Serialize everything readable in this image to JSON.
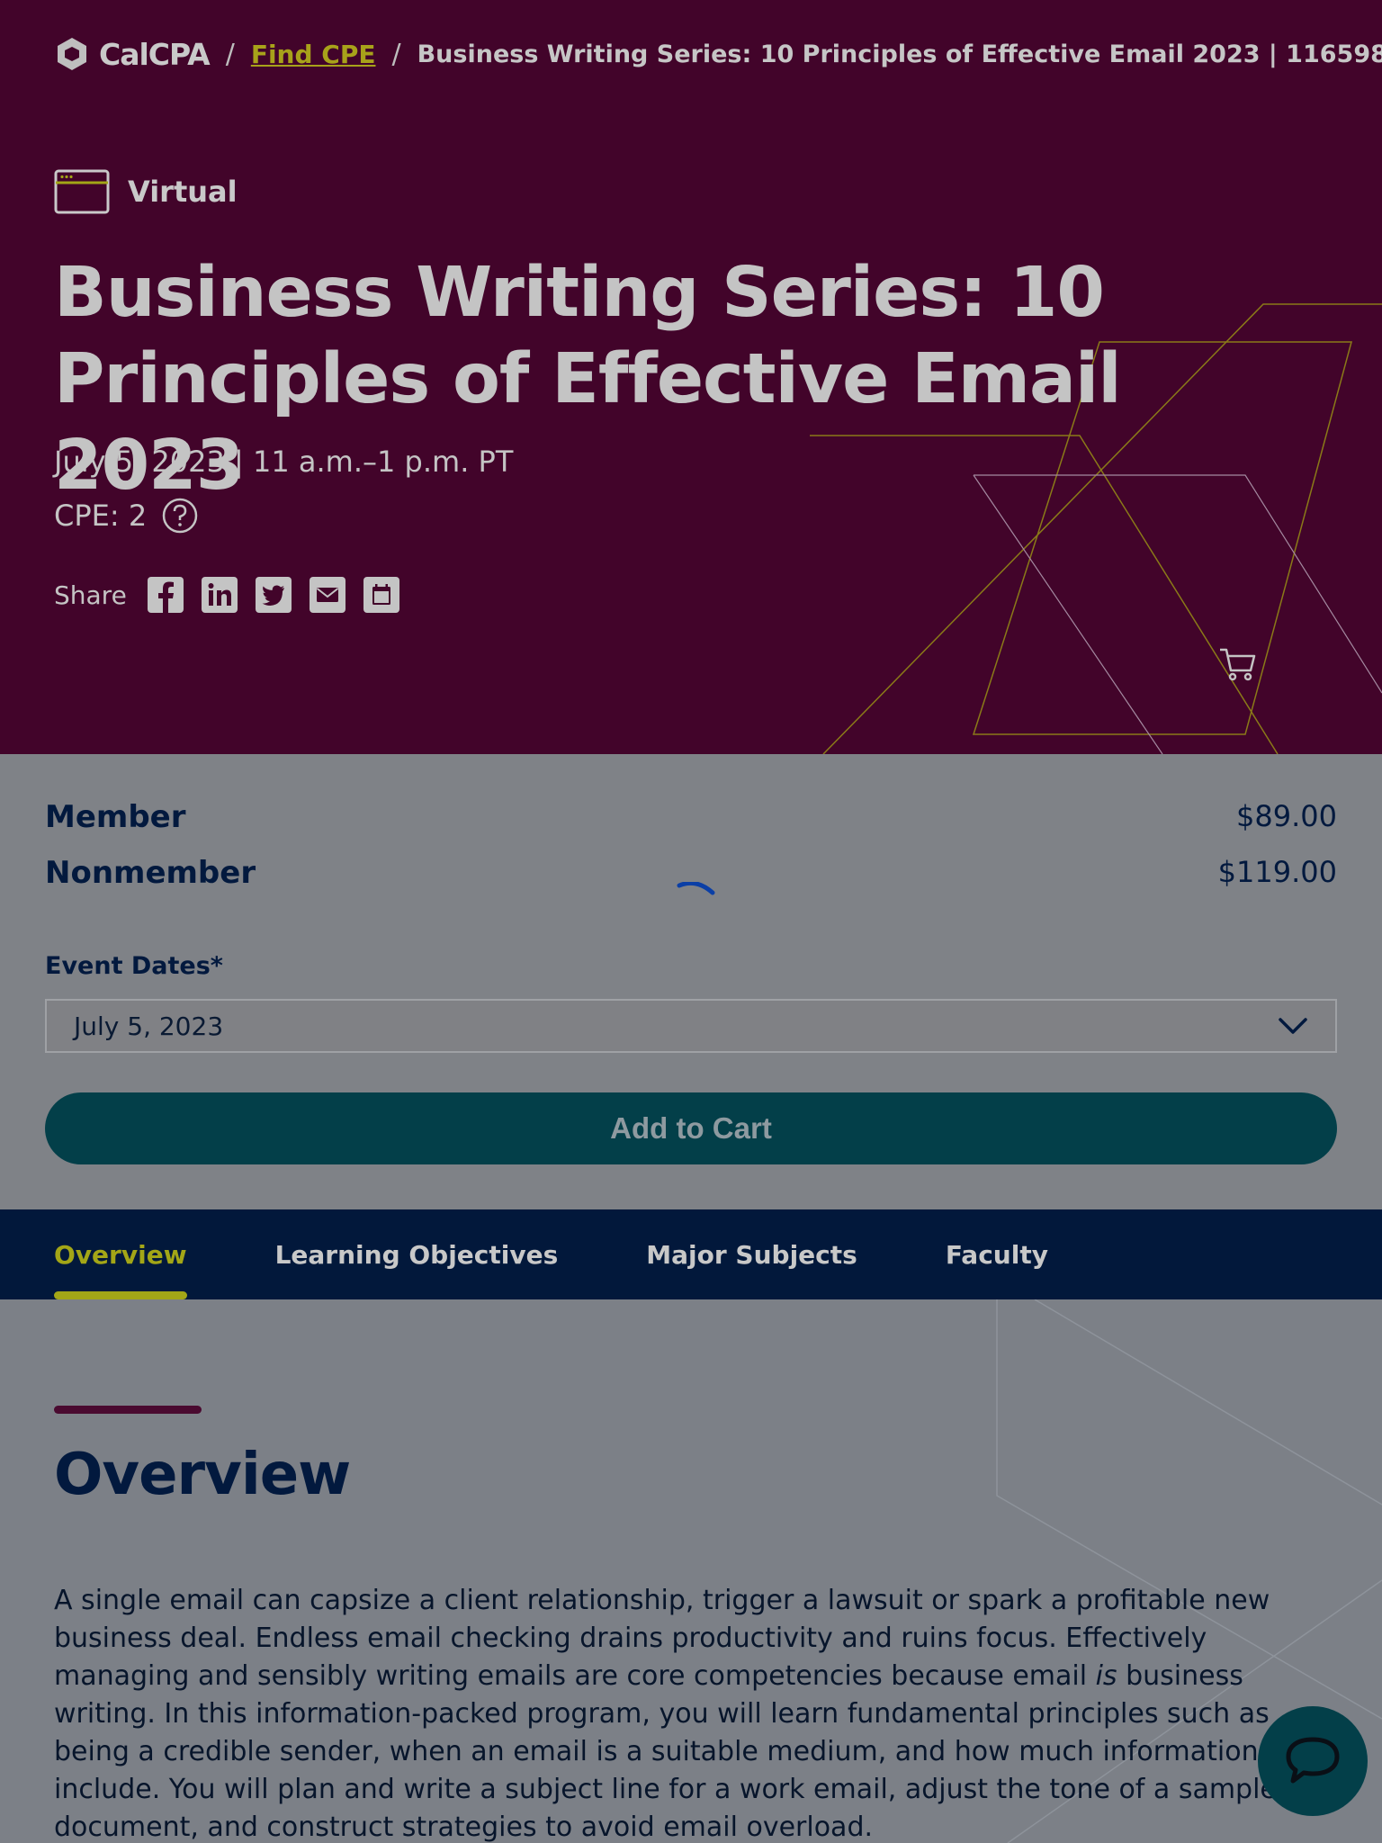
{
  "breadcrumb": {
    "logo_text": "CalCPA",
    "separator": "/",
    "link": "Find CPE",
    "current": "Business Writing Series: 10 Principles of Effective Email 2023 | 116598"
  },
  "event": {
    "format": "Virtual",
    "title": "Business Writing Series: 10 Principles of Effective Email 2023",
    "date_time": "July 5, 2023 | 11 a.m.–1 p.m. PT",
    "cpe": "CPE: 2"
  },
  "share": {
    "label": "Share",
    "icons": [
      "facebook-icon",
      "linkedin-icon",
      "twitter-icon",
      "email-icon",
      "calendar-icon"
    ]
  },
  "pricing": {
    "member_label": "Member",
    "member_price": "$89.00",
    "nonmember_label": "Nonmember",
    "nonmember_price": "$119.00"
  },
  "event_dates": {
    "label": "Event Dates*",
    "selected": "July 5, 2023"
  },
  "add_to_cart_label": "Add to Cart",
  "tabs": [
    {
      "label": "Overview",
      "active": true
    },
    {
      "label": "Learning Objectives",
      "active": false
    },
    {
      "label": "Major Subjects",
      "active": false
    },
    {
      "label": "Faculty",
      "active": false
    }
  ],
  "overview": {
    "heading": "Overview",
    "body_before": "A single email can capsize a client relationship, trigger a lawsuit or spark a profitable new business deal. Endless email checking drains productivity and ruins focus. Effectively managing and sensibly writing emails are core competencies because email ",
    "body_emphasis": "is",
    "body_after": " business writing. In this information-packed program, you will learn fundamental principles such as being a credible sender, when an email is a suitable medium, and how much information to include. You will plan and write a subject line for a work email, adjust the tone of a sample document, and construct strategies to avoid email overload."
  },
  "colors": {
    "hero_bg": "#42042a",
    "accent_olive": "#a3a617",
    "navy": "#02183b",
    "teal": "#033f49"
  }
}
